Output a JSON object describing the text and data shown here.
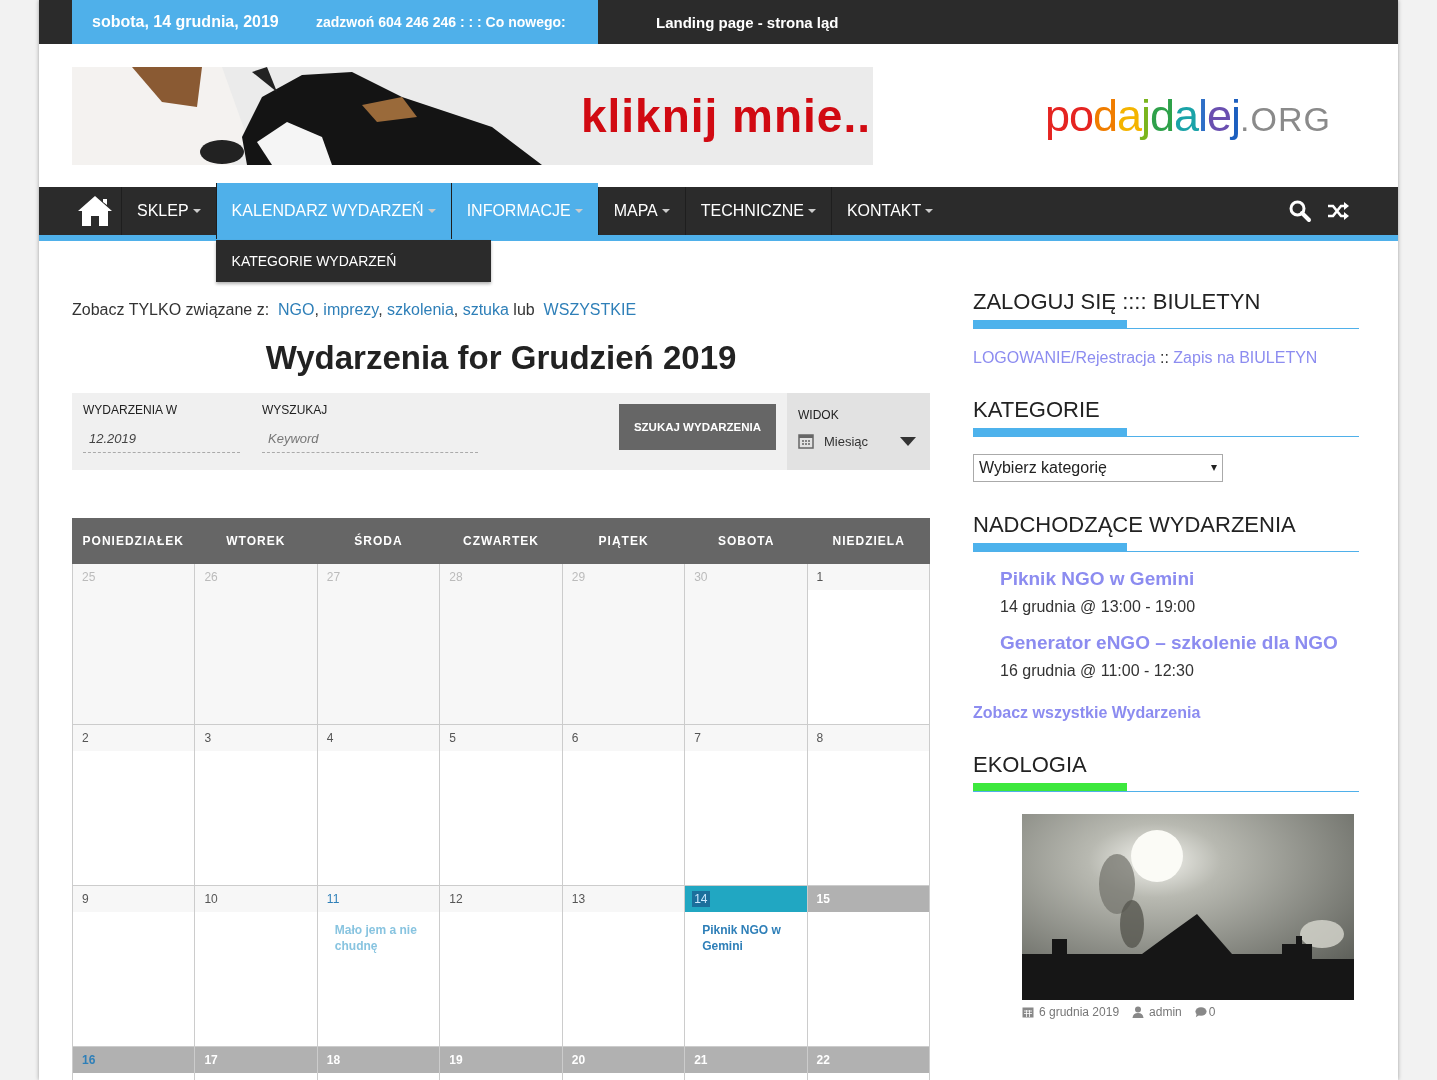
{
  "top_bar": {
    "date": "sobota, 14 grudnia, 2019",
    "phone": "zadzwoń 604 246 246 : : : Co nowego:",
    "ticker": "Landing page - strona ląd"
  },
  "banner": {
    "kind": "picture",
    "text": "kliknij mnie.."
  },
  "logo": {
    "segments": [
      {
        "text": "po",
        "color": "#e52421"
      },
      {
        "text": "d",
        "color": "#f07d00"
      },
      {
        "text": "a",
        "color": "#f4b400"
      },
      {
        "text": "j",
        "color": "#7ab51d"
      },
      {
        "text": "d",
        "color": "#2ea14a"
      },
      {
        "text": "a",
        "color": "#1aa3a8"
      },
      {
        "text": "l",
        "color": "#2e6fc7"
      },
      {
        "text": "e",
        "color": "#6a4fb0"
      },
      {
        "text": "j",
        "color": "#1c5fbf"
      },
      {
        "text": ".ORG",
        "color": "#8a8a8a"
      }
    ]
  },
  "nav": {
    "items": [
      {
        "label": "SKLEP",
        "selected": false,
        "dropdown": true
      },
      {
        "label": "KALENDARZ WYDARZEŃ",
        "selected": true,
        "dropdown": true
      },
      {
        "label": "INFORMACJE",
        "selected": true,
        "dropdown": true
      },
      {
        "label": "MAPA",
        "selected": false,
        "dropdown": true
      },
      {
        "label": "TECHNICZNE",
        "selected": false,
        "dropdown": true
      },
      {
        "label": "KONTAKT",
        "selected": false,
        "dropdown": true
      }
    ],
    "submenu": [
      "KATEGORIE WYDARZEŃ"
    ]
  },
  "filter": {
    "prefix": "Zobacz TYLKO związane z:",
    "links": [
      "NGO",
      "imprezy",
      "szkolenia",
      "sztuka"
    ],
    "separator": ",",
    "joiner": "lub",
    "all": "WSZYSTKIE"
  },
  "title": "Wydarzenia for Grudzień 2019",
  "search_bar": {
    "month_label": "WYDARZENIA W",
    "month_value": "12.2019",
    "search_label": "WYSZUKAJ",
    "search_placeholder": "Keyword",
    "button": "SZUKAJ WYDARZENIA",
    "view_label": "WIDOK",
    "view_value": "Miesiąc"
  },
  "calendar": {
    "columns": [
      "PONIEDZIAŁEK",
      "WTOREK",
      "ŚRODA",
      "CZWARTEK",
      "PIĄTEK",
      "SOBOTA",
      "NIEDZIELA"
    ],
    "weeks": [
      {
        "days": [
          {
            "num": "25",
            "kind": "other",
            "has_event": false
          },
          {
            "num": "26",
            "kind": "other",
            "has_event": false
          },
          {
            "num": "27",
            "kind": "other",
            "has_event": false
          },
          {
            "num": "28",
            "kind": "other",
            "has_event": false
          },
          {
            "num": "29",
            "kind": "other",
            "has_event": false
          },
          {
            "num": "30",
            "kind": "other",
            "has_event": false
          },
          {
            "num": "1",
            "kind": "past",
            "has_event": false
          }
        ]
      },
      {
        "days": [
          {
            "num": "2",
            "kind": "past",
            "has_event": false
          },
          {
            "num": "3",
            "kind": "past",
            "has_event": false
          },
          {
            "num": "4",
            "kind": "past",
            "has_event": false
          },
          {
            "num": "5",
            "kind": "past",
            "has_event": false
          },
          {
            "num": "6",
            "kind": "past",
            "has_event": false
          },
          {
            "num": "7",
            "kind": "past",
            "has_event": false
          },
          {
            "num": "8",
            "kind": "past",
            "has_event": false
          }
        ]
      },
      {
        "days": [
          {
            "num": "9",
            "kind": "past",
            "has_event": false
          },
          {
            "num": "10",
            "kind": "past",
            "has_event": false
          },
          {
            "num": "11",
            "kind": "past",
            "has_event": true,
            "events": [
              "Mało jem a nie chudnę"
            ]
          },
          {
            "num": "12",
            "kind": "past",
            "has_event": false
          },
          {
            "num": "13",
            "kind": "past",
            "has_event": false
          },
          {
            "num": "14",
            "kind": "today",
            "has_event": true,
            "events": [
              "Piknik NGO w Gemini"
            ]
          },
          {
            "num": "15",
            "kind": "future",
            "has_event": false
          }
        ]
      },
      {
        "days": [
          {
            "num": "16",
            "kind": "future",
            "has_event": true
          },
          {
            "num": "17",
            "kind": "future",
            "has_event": false
          },
          {
            "num": "18",
            "kind": "future",
            "has_event": false
          },
          {
            "num": "19",
            "kind": "future",
            "has_event": false
          },
          {
            "num": "20",
            "kind": "future",
            "has_event": false
          },
          {
            "num": "21",
            "kind": "future",
            "has_event": false
          },
          {
            "num": "22",
            "kind": "future",
            "has_event": false
          }
        ]
      }
    ]
  },
  "sidebar": [
    {
      "kind": "links",
      "title": "ZALOGUJ SIĘ :::: BIULETYN",
      "color": "#4db2ec",
      "links": [
        "LOGOWANIE/Rejestracja",
        "Zapis na BIULETYN"
      ],
      "separator": "::"
    },
    {
      "kind": "select",
      "title": "KATEGORIE",
      "color": "#4db2ec",
      "value": "Wybierz kategorię"
    },
    {
      "kind": "events",
      "title": "NADCHODZĄCE WYDARZENIA",
      "color": "#4db2ec",
      "events": [
        {
          "name": "Piknik NGO w Gemini",
          "when": "14 grudnia @ 13:00 - 19:00"
        },
        {
          "name": "Generator eNGO – szkolenie dla NGO",
          "when": "16 grudnia @ 11:00 - 12:30"
        }
      ],
      "more": "Zobacz wszystkie Wydarzenia"
    },
    {
      "kind": "post",
      "title": "EKOLOGIA",
      "color": "#3de83d",
      "date": "6 grudnia 2019",
      "author": "admin",
      "comments": "0"
    }
  ]
}
